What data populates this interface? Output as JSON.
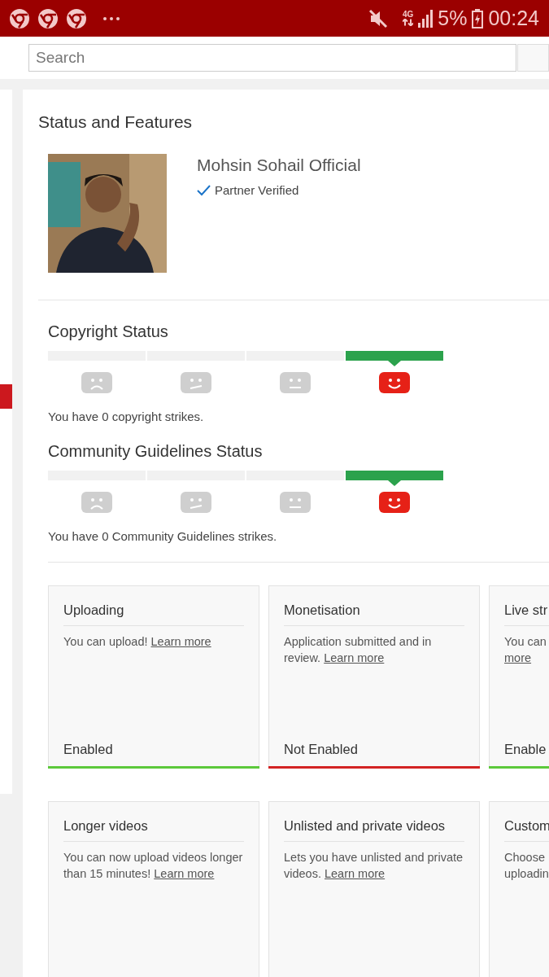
{
  "status_bar": {
    "network": "4G",
    "battery": "5%",
    "time": "00:24"
  },
  "search": {
    "placeholder": "Search"
  },
  "sidebar": {
    "selected_marker": true
  },
  "panel": {
    "title": "Status and Features",
    "channel": {
      "name": "Mohsin Sohail Official",
      "badge": "Partner Verified"
    },
    "meters": [
      {
        "title": "Copyright Status",
        "message": "You have 0 copyright strikes.",
        "segments": [
          {
            "kind": "sad",
            "selected": false
          },
          {
            "kind": "skeptical",
            "selected": false
          },
          {
            "kind": "neutral",
            "selected": false
          },
          {
            "kind": "happy",
            "selected": true
          }
        ]
      },
      {
        "title": "Community Guidelines Status",
        "message": "You have 0 Community Guidelines strikes.",
        "segments": [
          {
            "kind": "sad",
            "selected": false
          },
          {
            "kind": "skeptical",
            "selected": false
          },
          {
            "kind": "neutral",
            "selected": false
          },
          {
            "kind": "happy",
            "selected": true
          }
        ]
      }
    ],
    "features": [
      {
        "title": "Uploading",
        "description": "You can upload! ",
        "link": "Learn more",
        "status": "Enabled",
        "enabled": true
      },
      {
        "title": "Monetisation",
        "description": "Application submitted and in review. ",
        "link": "Learn more",
        "status": "Not Enabled",
        "enabled": false
      },
      {
        "title": "Live str",
        "description": "You can\n",
        "link": "more",
        "status": "Enable",
        "enabled": true
      },
      {
        "title": "Longer videos",
        "description": "You can now upload videos longer than 15 minutes! ",
        "link": "Learn more"
      },
      {
        "title": "Unlisted and private videos",
        "description": "Lets you have unlisted and private videos. ",
        "link": "Learn more"
      },
      {
        "title": "Custom",
        "description": "Choose\nuploadin"
      }
    ]
  }
}
